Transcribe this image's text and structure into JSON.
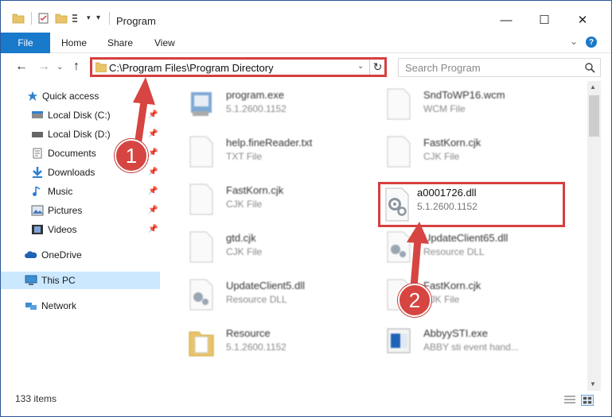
{
  "window": {
    "title": "Program",
    "controls": {
      "minimize": "—",
      "maximize": "☐",
      "close": "✕"
    }
  },
  "ribbon": {
    "tabs": [
      "File",
      "Home",
      "Share",
      "View"
    ],
    "expand_icon": "chevron-down-icon",
    "help_icon": "help-icon"
  },
  "address": {
    "path": "C:\\Program Files\\Program Directory",
    "search_placeholder": "Search Program"
  },
  "nav": {
    "items": [
      {
        "label": "Quick access",
        "icon": "star-icon"
      },
      {
        "label": "Local Disk (C:)",
        "icon": "drive-icon",
        "pinned": true
      },
      {
        "label": "Local Disk (D:)",
        "icon": "drive-icon",
        "pinned": true
      },
      {
        "label": "Documents",
        "icon": "documents-icon",
        "pinned": true
      },
      {
        "label": "Downloads",
        "icon": "download-icon",
        "pinned": true
      },
      {
        "label": "Music",
        "icon": "music-icon",
        "pinned": true
      },
      {
        "label": "Pictures",
        "icon": "pictures-icon",
        "pinned": true
      },
      {
        "label": "Videos",
        "icon": "videos-icon",
        "pinned": true
      },
      {
        "label": "OneDrive",
        "icon": "cloud-icon"
      },
      {
        "label": "This PC",
        "icon": "computer-icon",
        "selected": true
      },
      {
        "label": "Network",
        "icon": "network-icon"
      }
    ]
  },
  "files": [
    {
      "name": "program.exe",
      "sub": "5.1.2600.1152",
      "icon": "exe-icon"
    },
    {
      "name": "SndToWP16.wcm",
      "sub": "WCM File",
      "icon": "file-icon"
    },
    {
      "name": "help.fineReader.txt",
      "sub": "TXT File",
      "icon": "file-icon"
    },
    {
      "name": "FastKorn.cjk",
      "sub": "CJK File",
      "icon": "file-icon"
    },
    {
      "name": "FastKorn.cjk",
      "sub": "CJK File",
      "icon": "file-icon"
    },
    {
      "name": "a0001726.dll",
      "sub": "5.1.2600.1152",
      "icon": "dll-gear-icon",
      "highlighted": true
    },
    {
      "name": "gtd.cjk",
      "sub": "CJK File",
      "icon": "file-icon"
    },
    {
      "name": "UpdateClient65.dll",
      "sub": "Resource DLL",
      "icon": "dll-gear-icon"
    },
    {
      "name": "UpdateClient5.dll",
      "sub": "Resource DLL",
      "icon": "dll-gear-icon"
    },
    {
      "name": "FastKorn.cjk",
      "sub": "CJK File",
      "icon": "file-icon"
    },
    {
      "name": "Resource",
      "sub": "5.1.2600.1152",
      "icon": "folder-icon"
    },
    {
      "name": "AbbyySTI.exe",
      "sub": "ABBY sti event hand...",
      "icon": "exe-icon"
    }
  ],
  "status": {
    "item_count": "133 items"
  },
  "callouts": [
    "1",
    "2"
  ],
  "colors": {
    "accent": "#1979ca",
    "highlight": "#d63f3f",
    "selection": "#cce8ff"
  }
}
